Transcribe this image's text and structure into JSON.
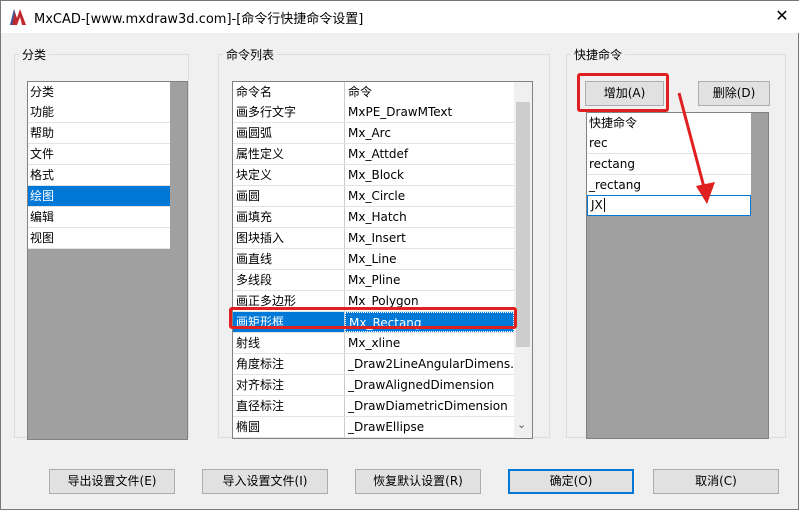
{
  "window": {
    "title": "MxCAD-[www.mxdraw3d.com]-[命令行快捷命令设置]",
    "close_glyph": "✕"
  },
  "category": {
    "group_label": "分类",
    "header": "分类",
    "items": [
      "功能",
      "帮助",
      "文件",
      "格式",
      "绘图",
      "编辑",
      "视图"
    ],
    "selected_index": 4
  },
  "commands": {
    "group_label": "命令列表",
    "headers": [
      "命令名",
      "命令"
    ],
    "rows": [
      [
        "画多行文字",
        "MxPE_DrawMText"
      ],
      [
        "画圆弧",
        "Mx_Arc"
      ],
      [
        "属性定义",
        "Mx_Attdef"
      ],
      [
        "块定义",
        "Mx_Block"
      ],
      [
        "画圆",
        "Mx_Circle"
      ],
      [
        "画填充",
        "Mx_Hatch"
      ],
      [
        "图块插入",
        "Mx_Insert"
      ],
      [
        "画直线",
        "Mx_Line"
      ],
      [
        "多线段",
        "Mx_Pline"
      ],
      [
        "画正多边形",
        "Mx_Polygon"
      ],
      [
        "画矩形框",
        "Mx_Rectang"
      ],
      [
        "射线",
        "Mx_xline"
      ],
      [
        "角度标注",
        "_Draw2LineAngularDimens..."
      ],
      [
        "对齐标注",
        "_DrawAlignedDimension"
      ],
      [
        "直径标注",
        "_DrawDiametricDimension"
      ],
      [
        "椭圆",
        "_DrawEllipse"
      ]
    ],
    "selected_index": 10,
    "scroll_down_glyph": "⌄"
  },
  "shortcuts": {
    "group_label": "快捷命令",
    "add_label": "增加(A)",
    "delete_label": "删除(D)",
    "header": "快捷命令",
    "items": [
      "rec",
      "rectang",
      "_rectang"
    ],
    "edit_value": "JX"
  },
  "footer": {
    "export_label": "导出设置文件(E)",
    "import_label": "导入设置文件(I)",
    "restore_label": "恢复默认设置(R)",
    "ok_label": "确定(O)",
    "cancel_label": "取消(C)"
  },
  "colors": {
    "selection": "#0078d7",
    "annotation": "#e02020"
  }
}
